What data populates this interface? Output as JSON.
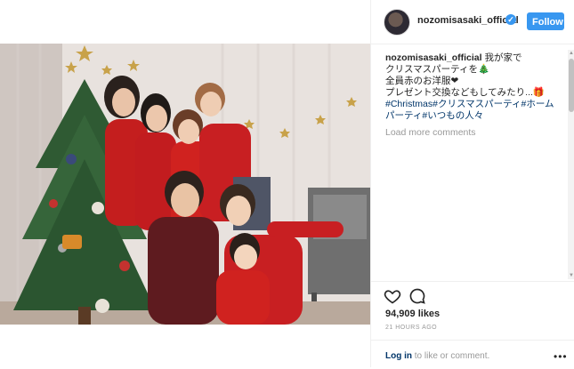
{
  "post": {
    "username": "nozomisasaki_official",
    "verified_icon": "verified-badge-icon",
    "follow_label": "Follow",
    "caption_lines": [
      "我が家で",
      "クリスマスパーティを🎄",
      "全員赤のお洋服❤",
      "プレゼント交換などもしてみたり...🎁"
    ],
    "hashtags_line1": [
      "#Christmas",
      "#クリスマスパーティ",
      "#ホーム"
    ],
    "hashtags_line2": [
      "パーティ",
      "#いつもの人々"
    ],
    "load_more": "Load more comments",
    "likes": "94,909 likes",
    "time_ago": "21 HOURS AGO",
    "login_link": "Log in",
    "login_rest": " to like or comment.",
    "more_icon": "more-options-icon"
  },
  "colors": {
    "accent": "#3897f0",
    "hashtag": "#003569",
    "muted": "#999999"
  }
}
